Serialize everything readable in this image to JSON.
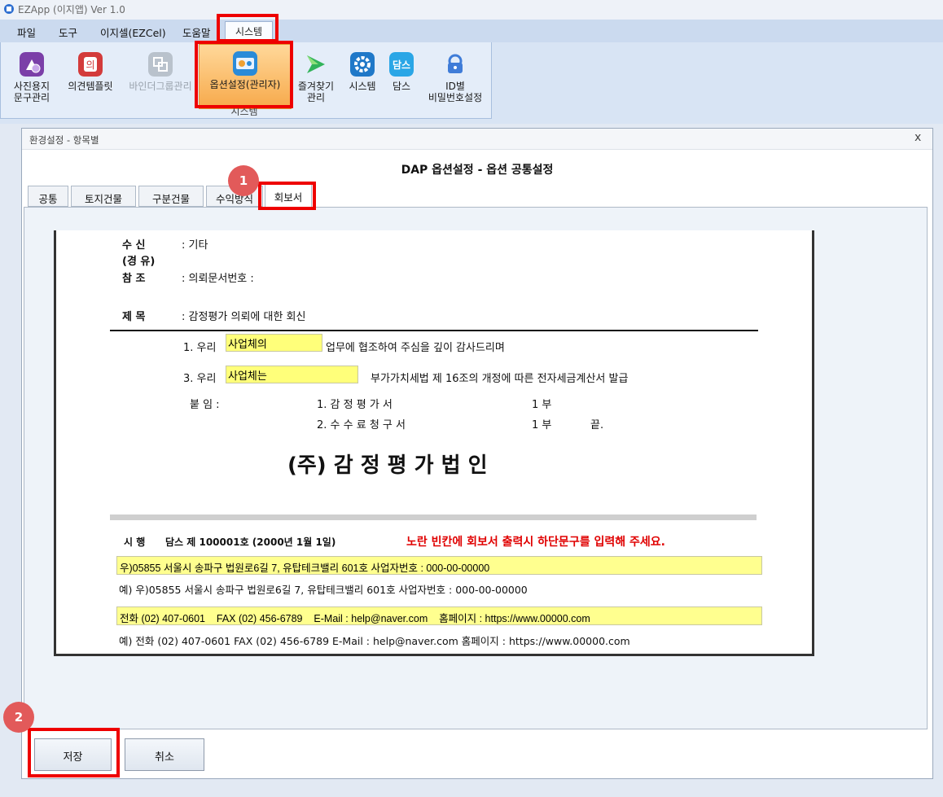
{
  "app": {
    "title": "EZApp (이지앱)  Ver 1.0"
  },
  "menu": [
    "파일",
    "도구",
    "이지셀(EZCel)",
    "도움말",
    "시스템"
  ],
  "ribbon": {
    "buttons": [
      {
        "line1": "사진용지",
        "line2": "문구관리",
        "icon": "photo-paper-icon",
        "color": "#7b3fa8"
      },
      {
        "line1": "의견템플릿",
        "line2": "",
        "icon": "opinion-template-icon",
        "color": "#d33b3b"
      },
      {
        "line1": "바인더그룹관리",
        "line2": "",
        "icon": "binder-group-icon",
        "color": "#b9c2cc"
      },
      {
        "line1": "옵션설정(관리자)",
        "line2": "",
        "icon": "options-settings-icon",
        "color": "#2a8bd8"
      },
      {
        "line1": "즐겨찾기",
        "line2": "관리",
        "icon": "favorites-icon",
        "color": "#31b35a"
      },
      {
        "line1": "시스템",
        "line2": "",
        "icon": "system-gear-icon",
        "color": "#1f78c8"
      },
      {
        "line1": "담스",
        "line2": "",
        "icon": "dams-icon",
        "color": "#2aa6e6"
      },
      {
        "line1": "ID별",
        "line2": "비밀번호설정",
        "icon": "id-password-icon",
        "color": "#3f7cd8"
      }
    ],
    "group_label": "시스템"
  },
  "dialog": {
    "title": "환경설정 - 항목별",
    "close": "x",
    "heading": "DAP 옵션설정 - 옵션 공통설정",
    "tabs": [
      "공통",
      "토지건물",
      "구분건물",
      "수익방식",
      "회보서"
    ],
    "save": "저장",
    "cancel": "취소"
  },
  "letter": {
    "recipient_label": "수     신",
    "recipient_value": ": 기타",
    "via_label": "(경   유)",
    "ref_label": "참     조",
    "ref_value": ": 의뢰문서번호 :",
    "subject_label": "제     목",
    "subject_value": ": 감정평가 의뢰에 대한 회신",
    "line1_prefix": "1. 우리",
    "line1_field": "사업체의",
    "line1_suffix": "업무에 협조하여 주심을 깊이 감사드리며",
    "line3_prefix": "3. 우리",
    "line3_field": "사업체는",
    "line3_suffix": "부가가치세법 제 16조의 개정에 따른 전자세금계산서 발급",
    "attach_label": "붙          임   :",
    "attach1": "1. 감 정 평 가 서",
    "attach1_qty": "1 부",
    "attach2": "2. 수 수 료 청 구 서",
    "attach2_qty": "1 부",
    "attach_end": "끝.",
    "company": "(주) 감 정 평 가 법 인",
    "footer_label": "시 행",
    "footer_value": "담스 제 100001호 (2000년 1월 1일)",
    "hint": "노란 빈칸에 회보서 출력시 하단문구를 입력해 주세요.",
    "address_field": "우)05855 서울시 송파구 법원로6길 7, 유탑테크밸리 601호 사업자번호 : 000-00-00000",
    "address_example": "예) 우)05855 서울시 송파구 법원로6길 7, 유탑테크밸리 601호 사업자번호 : 000-00-00000",
    "contact_field": "전화 (02) 407-0601    FAX (02) 456-6789    E-Mail : help@naver.com    홈페이지 : https://www.00000.com",
    "contact_example": "예) 전화 (02) 407-0601    FAX (02) 456-6789    E-Mail : help@naver.com    홈페이지 : https://www.00000.com"
  },
  "badges": [
    "1",
    "2"
  ]
}
